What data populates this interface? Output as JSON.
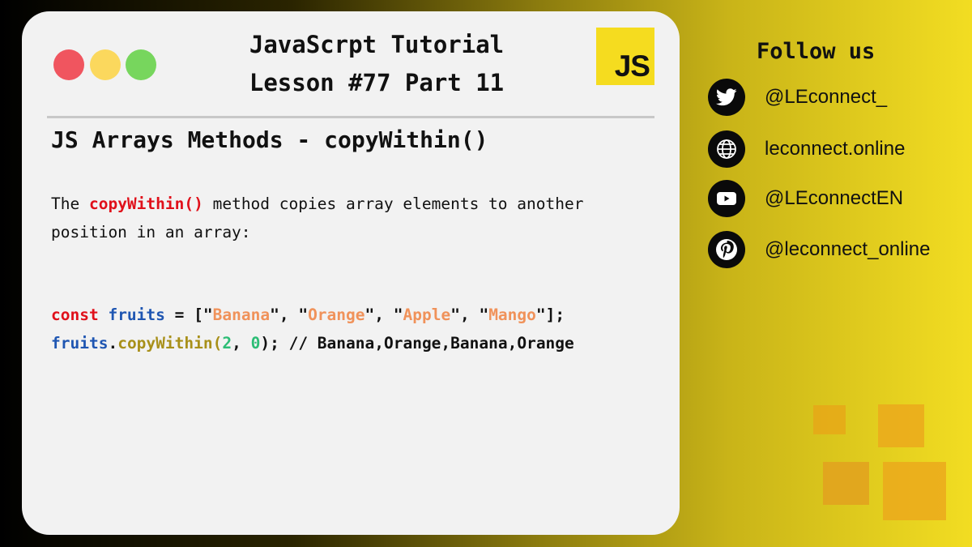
{
  "card": {
    "title_line1": "JavaScrpt Tutorial",
    "title_line2": "Lesson #77 Part 11",
    "logo_text": "JS",
    "subtitle": "JS Arrays Methods - copyWithin()",
    "description": {
      "prefix": "The ",
      "highlight": "copyWithin()",
      "suffix": " method copies array elements to another position in an array:"
    },
    "code": {
      "line1": {
        "keyword": "const",
        "var": "fruits",
        "op": " = [",
        "q": "\"",
        "s1": "Banana",
        "s2": "Orange",
        "s3": "Apple",
        "s4": "Mango",
        "sep": ", ",
        "end": "];"
      },
      "line2": {
        "var": "fruits",
        "dot": ".",
        "method": "copyWithin",
        "open": "(",
        "n1": "2",
        "comma": ", ",
        "n2": "0",
        "close": "); ",
        "comment": "// Banana,Orange,Banana,Orange"
      }
    }
  },
  "sidebar": {
    "heading": "Follow us",
    "links": [
      {
        "icon": "twitter-icon",
        "label": "@LEconnect_"
      },
      {
        "icon": "globe-icon",
        "label": "leconnect.online"
      },
      {
        "icon": "youtube-icon",
        "label": "@LEconnectEN"
      },
      {
        "icon": "pinterest-icon",
        "label": "@leconnect_online"
      }
    ]
  },
  "colors": {
    "keyword": "#e0101a",
    "variable": "#1f56b2",
    "string": "#f0925a",
    "method": "#a8901a",
    "number": "#2cbd75",
    "js_logo": "#f5dc1f"
  }
}
